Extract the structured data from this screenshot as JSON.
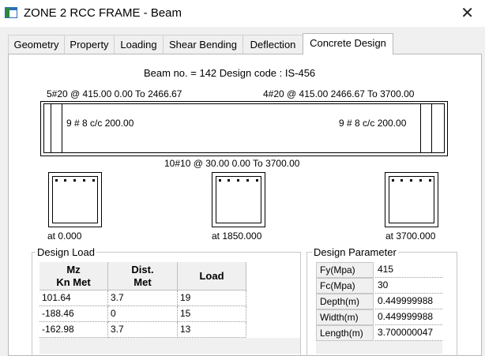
{
  "window": {
    "title": "ZONE 2 RCC FRAME  - Beam",
    "close_glyph": "✕"
  },
  "tabs": [
    {
      "label": "Geometry"
    },
    {
      "label": "Property"
    },
    {
      "label": "Loading"
    },
    {
      "label": "Shear Bending"
    },
    {
      "label": "Deflection"
    },
    {
      "label": "Concrete Design",
      "active": true
    }
  ],
  "design": {
    "header": "Beam no. = 142  Design code :  IS-456",
    "top_left_bars": "5#20 @ 415.00 0.00 To 2466.67",
    "top_right_bars": "4#20 @ 415.00 2466.67 To 3700.00",
    "stirrup_left": "9 # 8 c/c 200.00",
    "stirrup_right": "9 # 8 c/c 200.00",
    "bottom_bars": "10#10 @ 30.00 0.00 To 3700.00",
    "sections": [
      {
        "label": "at 0.000"
      },
      {
        "label": "at 1850.000"
      },
      {
        "label": "at 3700.000"
      }
    ]
  },
  "design_load": {
    "title": "Design Load",
    "headers": {
      "mz": "Mz\nKn Met",
      "dist": "Dist.\nMet",
      "load": "Load"
    },
    "rows": [
      {
        "mz": "101.64",
        "dist": "3.7",
        "load": "19"
      },
      {
        "mz": "-188.46",
        "dist": "0",
        "load": "15"
      },
      {
        "mz": "-162.98",
        "dist": "3.7",
        "load": "13"
      }
    ]
  },
  "design_parameter": {
    "title": "Design Parameter",
    "rows": [
      {
        "label": "Fy(Mpa)",
        "value": "415"
      },
      {
        "label": "Fc(Mpa)",
        "value": "30"
      },
      {
        "label": "Depth(m)",
        "value": "0.449999988"
      },
      {
        "label": "Width(m)",
        "value": "0.449999988"
      },
      {
        "label": "Length(m)",
        "value": "3.700000047"
      }
    ]
  }
}
